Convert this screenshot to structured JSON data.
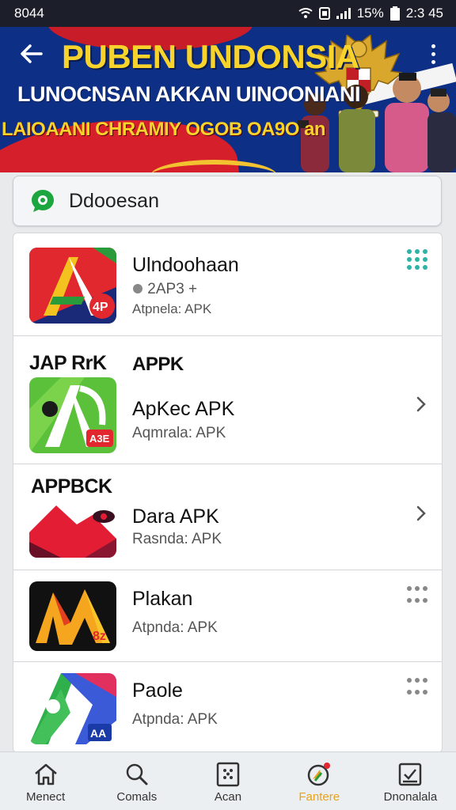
{
  "status_bar": {
    "time": "8044",
    "battery": "15%",
    "clock": "2:3 45"
  },
  "banner": {
    "title": "PUBEN UNDONSIA",
    "subtitle": "LUNOCNSAN AKKAN UINOONIANI",
    "tagline": "LAIOAANI CHRAMIY OGOB OA9O an",
    "colors": {
      "blue": "#0e2f86",
      "red": "#d51f2a",
      "yellow": "#f7d32b"
    }
  },
  "search": {
    "text": "Ddooesan",
    "icon": "chat-bubble-icon",
    "icon_color": "#1da63f"
  },
  "sections": {
    "section_1_label": "JAP RrK",
    "section_1_sub": "APPK",
    "section_2_label": "APPBCK"
  },
  "apps": [
    {
      "name": "Ulndoohaan",
      "meta": "2AP3 +",
      "size": "Atpnela: APK",
      "icon": "red-a-app-icon",
      "action": "grid"
    },
    {
      "name": "ApKec APK",
      "size": "Aqmrala: APK",
      "icon": "green-a-app-icon",
      "action": "chevron"
    },
    {
      "name": "Dara APK",
      "size": "Rasnda: APK",
      "icon": "red-mountain-app-icon",
      "action": "chevron"
    },
    {
      "name": "Plakan",
      "size": "Atpnda: APK",
      "icon": "orange-m-app-icon",
      "action": "grid"
    },
    {
      "name": "Paole",
      "size": "Atpnda: APK",
      "icon": "blue-a-app-icon",
      "action": "grid"
    }
  ],
  "bottom_nav": [
    {
      "label": "Menect",
      "icon": "home-icon"
    },
    {
      "label": "Comals",
      "icon": "search-icon"
    },
    {
      "label": "Acan",
      "icon": "apps-icon"
    },
    {
      "label": "Fantere",
      "icon": "notification-icon",
      "active": true
    },
    {
      "label": "Dnonalala",
      "icon": "download-icon"
    }
  ],
  "accent_color": "#e9a21a"
}
